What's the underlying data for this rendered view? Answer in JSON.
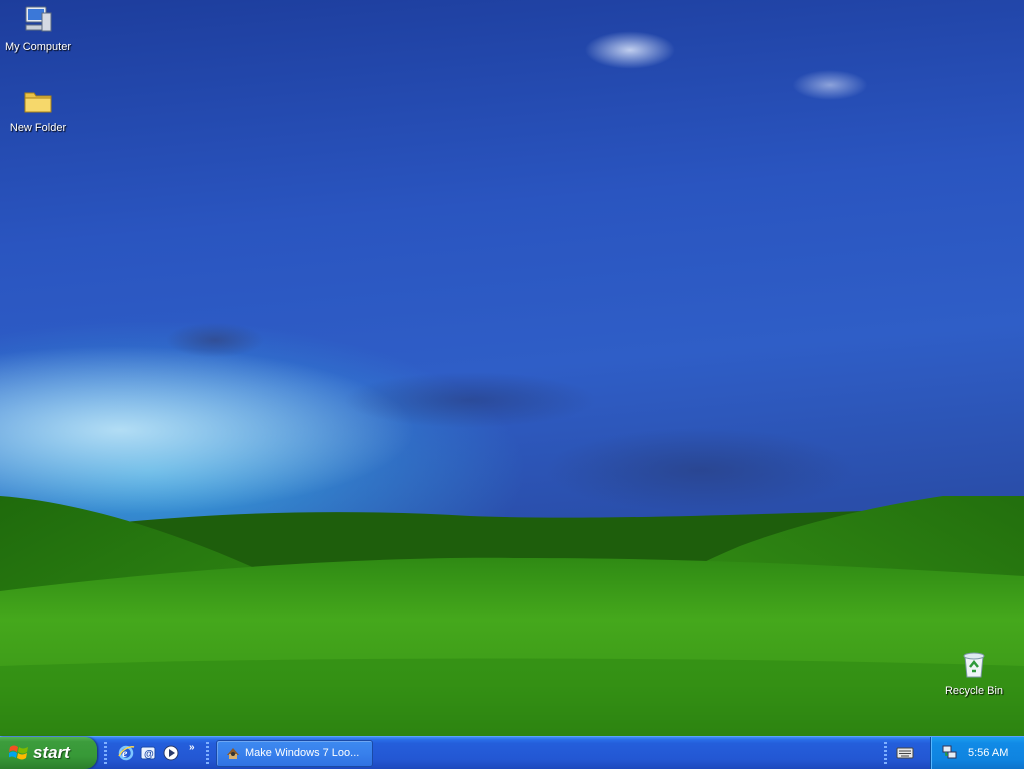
{
  "desktop": {
    "icons": [
      {
        "label": "My Computer",
        "icon": "computer-icon"
      },
      {
        "label": "New Folder",
        "icon": "folder-icon"
      },
      {
        "label": "Recycle Bin",
        "icon": "recycle-bin-icon"
      }
    ]
  },
  "taskbar": {
    "start_label": "start",
    "quick_launch": [
      {
        "icon": "internet-explorer-icon"
      },
      {
        "icon": "email-icon"
      },
      {
        "icon": "media-player-icon"
      }
    ],
    "quick_launch_more": "»",
    "task_buttons": [
      {
        "label": "Make Windows 7 Loo...",
        "icon": "app-icon"
      }
    ],
    "tray": {
      "icons": [
        "keyboard-icon",
        "network-icon"
      ],
      "clock": "5:56 AM"
    }
  },
  "colors": {
    "taskbar_blue": "#245edb",
    "start_green": "#3c9c3c",
    "tray_blue": "#118ae6"
  }
}
